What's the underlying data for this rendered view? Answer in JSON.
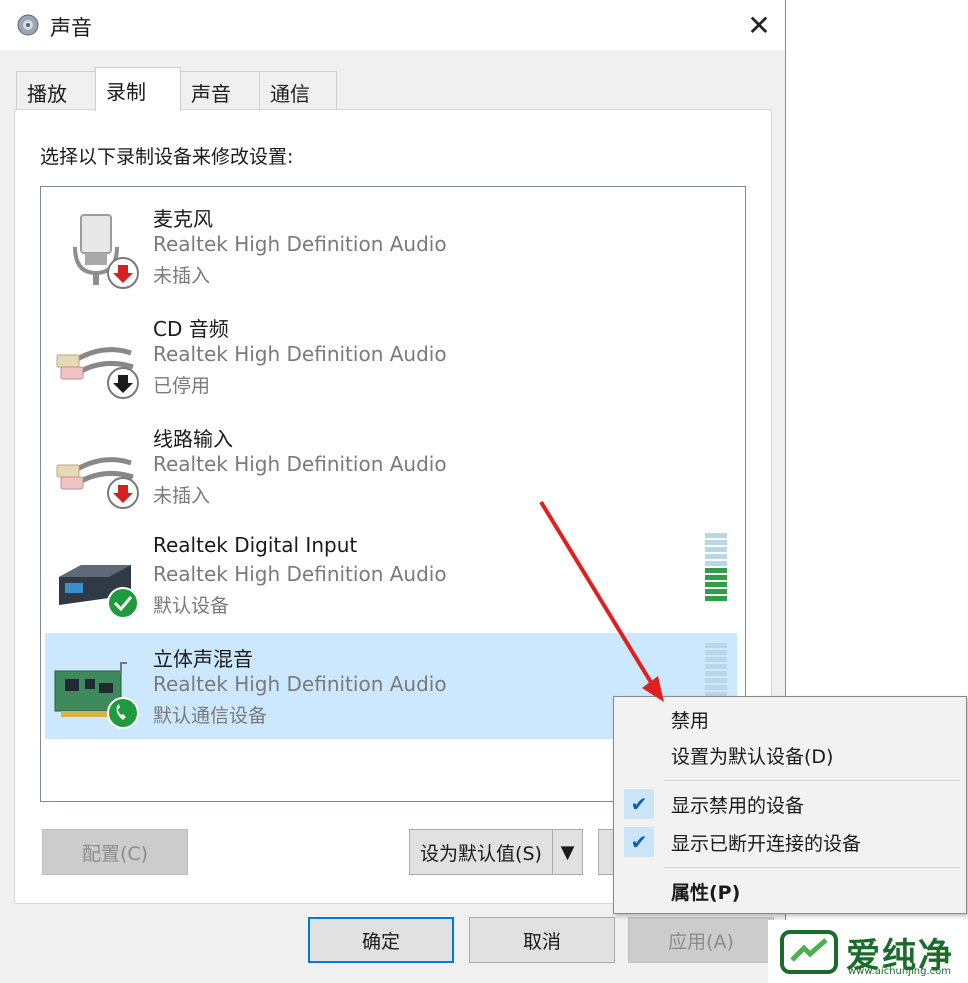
{
  "window": {
    "title": "声音",
    "close_label": "✕"
  },
  "tabs": [
    {
      "label": "播放",
      "active": false
    },
    {
      "label": "录制",
      "active": true
    },
    {
      "label": "声音",
      "active": false
    },
    {
      "label": "通信",
      "active": false
    }
  ],
  "instruction": "选择以下录制设备来修改设置:",
  "devices": [
    {
      "name": "麦克风",
      "driver": "Realtek High Definition Audio",
      "status": "未插入",
      "icon": "microphone-icon",
      "badge": "red-down-arrow-badge"
    },
    {
      "name": "CD 音频",
      "driver": "Realtek High Definition Audio",
      "status": "已停用",
      "icon": "rca-cable-icon",
      "badge": "black-down-arrow-badge"
    },
    {
      "name": "线路输入",
      "driver": "Realtek High Definition Audio",
      "status": "未插入",
      "icon": "rca-cable-icon",
      "badge": "red-down-arrow-badge"
    },
    {
      "name": "Realtek Digital Input",
      "driver": "Realtek High Definition Audio",
      "status": "默认设备",
      "icon": "digital-input-box-icon",
      "badge": "green-check-badge",
      "level": 0.5
    },
    {
      "name": "立体声混音",
      "driver": "Realtek High Definition Audio",
      "status": "默认通信设备",
      "icon": "sound-card-icon",
      "badge": "green-phone-badge",
      "level": 0,
      "selected": true
    }
  ],
  "buttons": {
    "configure": "配置(C)",
    "set_default": "设为默认值(S)",
    "ok": "确定",
    "cancel": "取消",
    "apply": "应用(A)"
  },
  "context_menu": {
    "items": [
      {
        "label": "禁用",
        "checked": false,
        "bold": false
      },
      {
        "label": "设置为默认设备(D)",
        "checked": false,
        "bold": false
      },
      {
        "label": "显示禁用的设备",
        "checked": true,
        "bold": false
      },
      {
        "label": "显示已断开连接的设备",
        "checked": true,
        "bold": false
      },
      {
        "label": "属性(P)",
        "checked": false,
        "bold": true
      }
    ]
  },
  "watermark": {
    "text": "爱纯净",
    "url": "www.aichunjing.com"
  },
  "colors": {
    "selection": "#cce8ff",
    "accent": "#0078d7",
    "level_active": "#2ea043",
    "annotation_arrow": "#e02020"
  }
}
